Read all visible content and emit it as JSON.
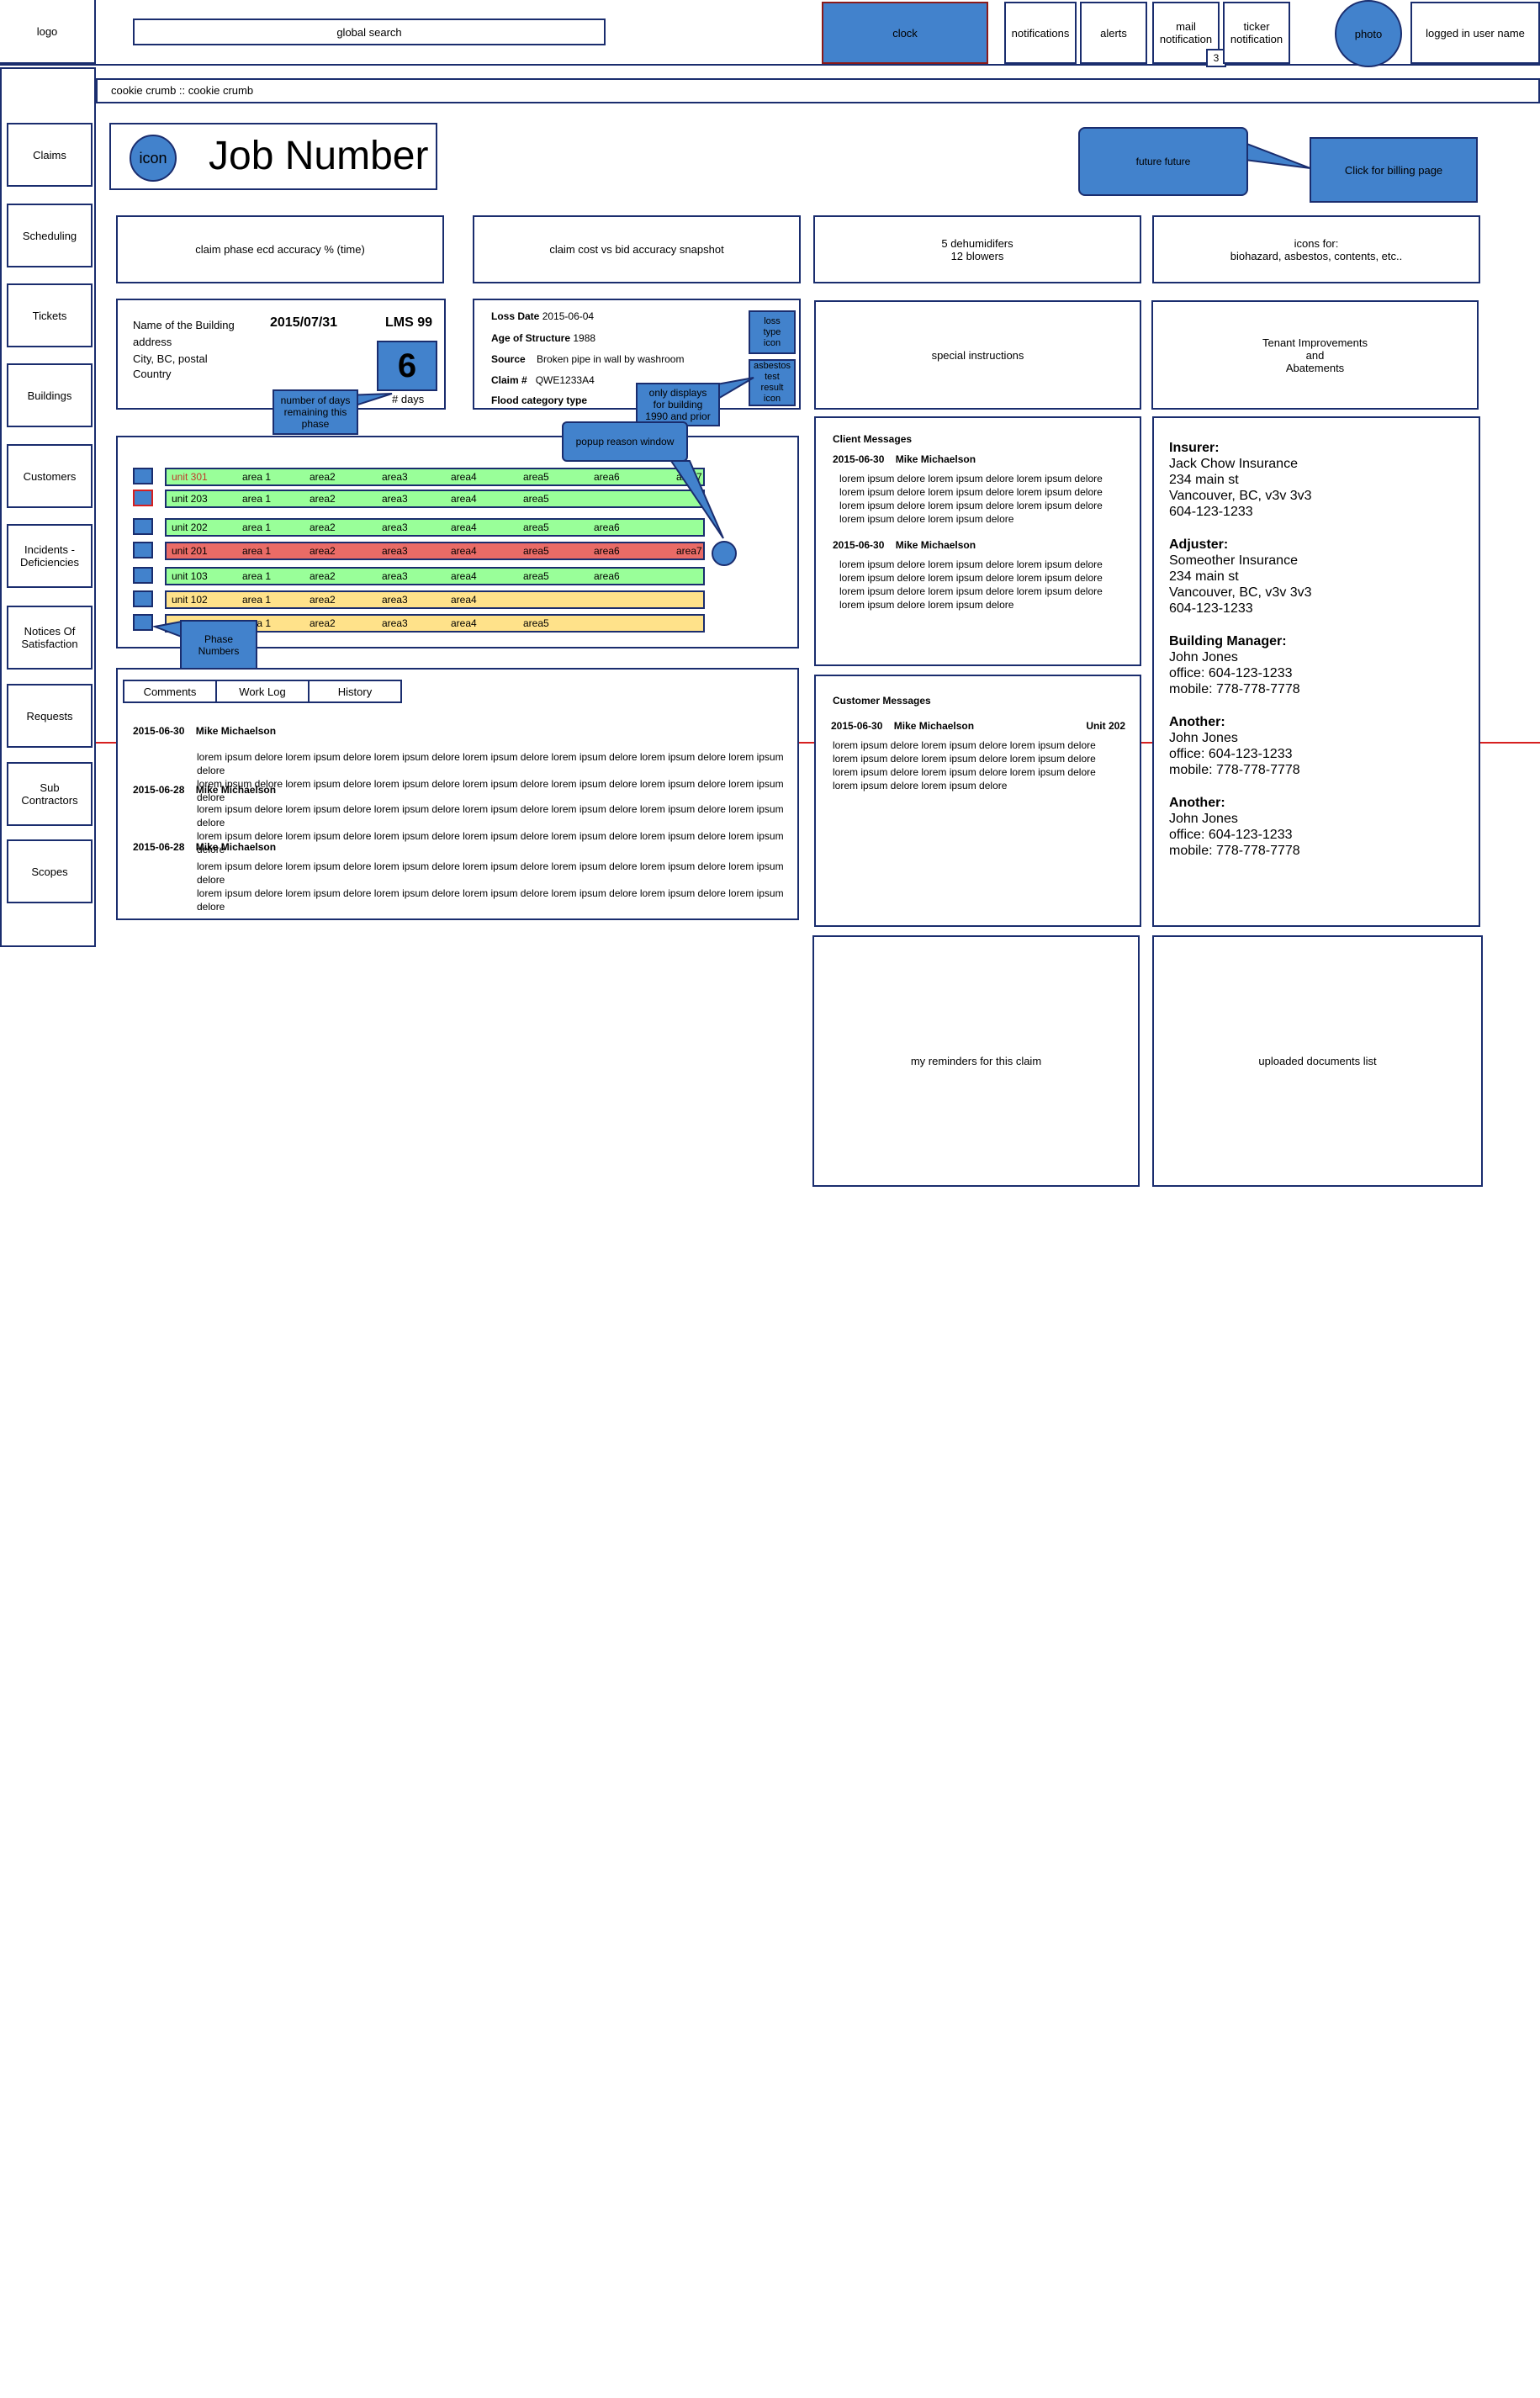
{
  "header": {
    "logo": "logo",
    "search_label": "global search",
    "clock": "clock",
    "notifications": "notifications",
    "alerts": "alerts",
    "mail_line1": "mail",
    "mail_line2": "notification",
    "mail_count": "3",
    "ticker_line1": "ticker",
    "ticker_line2": "notification",
    "photo": "photo",
    "user": "logged in user name"
  },
  "breadcrumb": "cookie crumb :: cookie crumb",
  "sidebar": {
    "items": [
      {
        "line1": "Claims",
        "line2": ""
      },
      {
        "line1": "Scheduling",
        "line2": ""
      },
      {
        "line1": "Tickets",
        "line2": ""
      },
      {
        "line1": "Buildings",
        "line2": ""
      },
      {
        "line1": "Customers",
        "line2": ""
      },
      {
        "line1": "Incidents -",
        "line2": "Deficiencies"
      },
      {
        "line1": "Notices Of",
        "line2": "Satisfaction"
      },
      {
        "line1": "Requests",
        "line2": ""
      },
      {
        "line1": "Sub",
        "line2": "Contractors"
      },
      {
        "line1": "Scopes",
        "line2": ""
      }
    ]
  },
  "job": {
    "icon": "icon",
    "title": "Job Number"
  },
  "callouts": {
    "future": "future future",
    "billing": "Click for billing page",
    "days_line1": "number of days",
    "days_line2": "remaining this",
    "days_line3": "phase",
    "only_line1": "only displays",
    "only_line2": "for building",
    "only_line3": "1990 and prior",
    "popup": "popup reason window",
    "phase_line1": "Phase",
    "phase_line2": "Numbers"
  },
  "stats": {
    "ecd": "claim phase ecd accuracy % (time)",
    "cost": "claim cost vs bid accuracy snapshot",
    "equip_line1": "5 dehumidifers",
    "equip_line2": "12 blowers",
    "icons_line1": "icons for:",
    "icons_line2": "biohazard, asbestos, contents, etc.."
  },
  "building": {
    "name": "Name of the Building",
    "address": "address",
    "city": "City, BC, postal",
    "country": "Country",
    "date": "2015/07/31",
    "lms": "LMS 99",
    "days_number": "6",
    "days_label": "# days"
  },
  "loss": {
    "date_label": "Loss Date",
    "date_value": "2015-06-04",
    "age_label": "Age of Structure",
    "age_value": "1988",
    "source_label": "Source",
    "source_value": "Broken pipe in wall by washroom",
    "claim_label": "Claim #",
    "claim_value": "QWE1233A4",
    "flood_label": "Flood category type",
    "loss_icon_line1": "loss",
    "loss_icon_line2": "type",
    "loss_icon_line3": "icon",
    "asb_line1": "asbestos",
    "asb_line2": "test",
    "asb_line3": "result",
    "asb_line4": "icon"
  },
  "special_instructions": "special instructions",
  "tenant": {
    "line1": "Tenant Improvements",
    "line2": "and",
    "line3": "Abatements"
  },
  "units": [
    {
      "unit": "unit 301",
      "color": "#99ff99",
      "areas": [
        "area 1",
        "area2",
        "area3",
        "area4",
        "area5",
        "area6",
        "area7"
      ]
    },
    {
      "unit": "unit 203",
      "color": "#99ff99",
      "areas": [
        "area 1",
        "area2",
        "area3",
        "area4",
        "area5"
      ]
    },
    {
      "unit": "unit 202",
      "color": "#99ff99",
      "areas": [
        "area 1",
        "area2",
        "area3",
        "area4",
        "area5",
        "area6"
      ]
    },
    {
      "unit": "unit 201",
      "color": "#ea6b66",
      "areas": [
        "area 1",
        "area2",
        "area3",
        "area4",
        "area5",
        "area6",
        "area7"
      ]
    },
    {
      "unit": "unit 103",
      "color": "#99ff99",
      "areas": [
        "area 1",
        "area2",
        "area3",
        "area4",
        "area5",
        "area6"
      ]
    },
    {
      "unit": "unit 102",
      "color": "#ffe28a",
      "areas": [
        "area 1",
        "area2",
        "area3",
        "area4"
      ]
    },
    {
      "unit": "",
      "color": "#ffe28a",
      "areas": [
        "area 1",
        "area2",
        "area3",
        "area4",
        "area5"
      ]
    }
  ],
  "tabs": {
    "comments": "Comments",
    "worklog": "Work Log",
    "history": "History"
  },
  "comments": [
    {
      "date": "2015-06-30",
      "author": "Mike Michaelson",
      "lines": [
        "lorem ipsum delore lorem ipsum delore lorem ipsum delore lorem ipsum delore lorem ipsum delore lorem ipsum delore lorem ipsum delore",
        "lorem ipsum delore lorem ipsum delore lorem ipsum delore lorem ipsum delore lorem ipsum delore lorem ipsum delore lorem ipsum delore"
      ]
    },
    {
      "date": "2015-06-28",
      "author": "Mike Michaelson",
      "lines": [
        "lorem ipsum delore lorem ipsum delore lorem ipsum delore lorem ipsum delore lorem ipsum delore lorem ipsum delore lorem ipsum delore",
        "lorem ipsum delore lorem ipsum delore lorem ipsum delore lorem ipsum delore lorem ipsum delore lorem ipsum delore lorem ipsum delore"
      ]
    },
    {
      "date": "2015-06-28",
      "author": "Mike Michaelson",
      "lines": [
        "lorem ipsum delore lorem ipsum delore lorem ipsum delore lorem ipsum delore lorem ipsum delore lorem ipsum delore lorem ipsum delore",
        "lorem ipsum delore lorem ipsum delore lorem ipsum delore lorem ipsum delore lorem ipsum delore lorem ipsum delore lorem ipsum delore"
      ]
    }
  ],
  "client_messages": {
    "title": "Client Messages",
    "items": [
      {
        "date": "2015-06-30",
        "author": "Mike Michaelson",
        "lines": [
          "lorem ipsum delore lorem ipsum delore lorem ipsum delore",
          "lorem ipsum delore lorem ipsum delore lorem ipsum delore",
          "lorem ipsum delore lorem ipsum delore lorem ipsum delore",
          "lorem ipsum delore lorem ipsum delore"
        ]
      },
      {
        "date": "2015-06-30",
        "author": "Mike Michaelson",
        "lines": [
          "lorem ipsum delore lorem ipsum delore lorem ipsum delore",
          "lorem ipsum delore lorem ipsum delore lorem ipsum delore",
          "lorem ipsum delore lorem ipsum delore lorem ipsum delore",
          "lorem ipsum delore lorem ipsum delore"
        ]
      }
    ]
  },
  "customer_messages": {
    "title": "Customer Messages",
    "date": "2015-06-30",
    "author": "Mike Michaelson",
    "unit": "Unit 202",
    "lines": [
      "lorem ipsum delore lorem ipsum delore lorem ipsum delore",
      "lorem ipsum delore lorem ipsum delore lorem ipsum delore",
      "lorem ipsum delore lorem ipsum delore lorem ipsum delore",
      "lorem ipsum delore lorem ipsum delore"
    ]
  },
  "contacts": [
    {
      "title": "Insurer:",
      "lines": [
        "Jack Chow Insurance",
        "234 main st",
        "Vancouver, BC, v3v 3v3",
        "604-123-1233"
      ]
    },
    {
      "title": "Adjuster:",
      "lines": [
        "Someother Insurance",
        "234 main st",
        "Vancouver, BC, v3v 3v3",
        "604-123-1233"
      ]
    },
    {
      "title": "Building Manager:",
      "lines": [
        "John Jones",
        "office: 604-123-1233",
        "mobile: 778-778-7778"
      ]
    },
    {
      "title": "Another:",
      "lines": [
        "John Jones",
        "office: 604-123-1233",
        "mobile: 778-778-7778"
      ]
    },
    {
      "title": "Another:",
      "lines": [
        "John Jones",
        "office: 604-123-1233",
        "mobile: 778-778-7778"
      ]
    }
  ],
  "reminders": "my reminders for this claim",
  "documents": "uploaded documents list",
  "colors": {
    "primary": "#4282cc",
    "border": "#1a2d6e",
    "green": "#99ff99",
    "red": "#ea6b66",
    "yellow": "#ffe28a",
    "guide": "#d62020"
  }
}
